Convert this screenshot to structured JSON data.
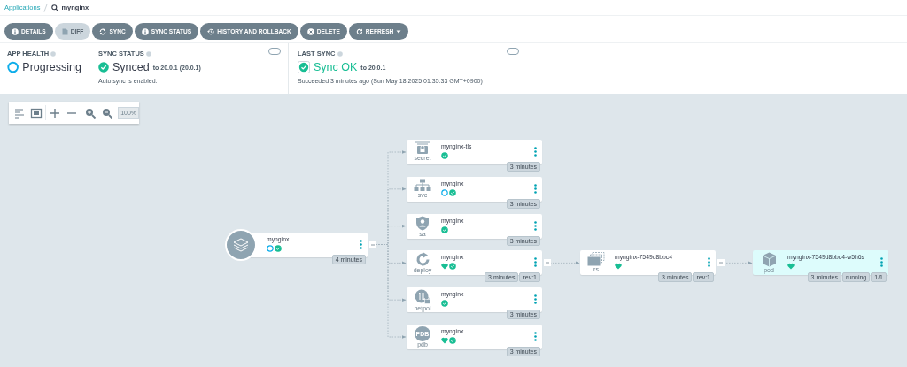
{
  "breadcrumb": [
    {
      "label": "Applications",
      "kind": "link"
    },
    {
      "label": "mynginx",
      "kind": "current"
    }
  ],
  "actions": [
    {
      "label": "DETAILS",
      "kind": "info",
      "disabled": false
    },
    {
      "label": "DIFF",
      "kind": "file",
      "disabled": true
    },
    {
      "label": "SYNC",
      "kind": "sync",
      "disabled": false
    },
    {
      "label": "SYNC STATUS",
      "kind": "info",
      "disabled": false
    },
    {
      "label": "HISTORY AND ROLLBACK",
      "kind": "history",
      "disabled": false
    },
    {
      "label": "DELETE",
      "kind": "delete",
      "disabled": false
    },
    {
      "label": "REFRESH",
      "kind": "refresh",
      "disabled": false,
      "dropdown": true
    }
  ],
  "summary": {
    "app_health": {
      "label": "APP HEALTH",
      "kind": "progressing",
      "value": "Progressing"
    },
    "sync_status": {
      "label": "SYNC STATUS",
      "kind": "synced",
      "value": "Synced",
      "revision": "to 20.0.1 (20.0.1)",
      "note": "Auto sync is enabled."
    },
    "last_sync": {
      "label": "LAST SYNC",
      "kind": "succeeded",
      "value": "Sync OK",
      "revision": "to 20.0.1",
      "note": "Succeeded 3 minutes ago (Sun May 18 2025 01:35:33 GMT+0900)"
    }
  },
  "graph": {
    "zoom": "100%",
    "root": {
      "kind": "app",
      "name": "mynginx",
      "statuses": [
        {
          "kind": "progressing"
        },
        {
          "kind": "synced"
        }
      ],
      "tags": [
        "4 minutes"
      ],
      "expanded": true,
      "children": [
        {
          "kind": "secret",
          "type_label": "secret",
          "name": "mynginx-tls",
          "statuses": [
            {
              "kind": "synced"
            }
          ],
          "tags": [
            "3 minutes"
          ]
        },
        {
          "kind": "svc",
          "type_label": "svc",
          "name": "mynginx",
          "statuses": [
            {
              "kind": "progressing"
            },
            {
              "kind": "synced"
            }
          ],
          "tags": [
            "3 minutes"
          ]
        },
        {
          "kind": "sa",
          "type_label": "sa",
          "name": "mynginx",
          "statuses": [
            {
              "kind": "synced"
            }
          ],
          "tags": [
            "3 minutes"
          ]
        },
        {
          "kind": "deploy",
          "type_label": "deploy",
          "name": "mynginx",
          "statuses": [
            {
              "kind": "healthy"
            },
            {
              "kind": "synced"
            }
          ],
          "tags": [
            "3 minutes",
            "rev:1"
          ],
          "expanded": true,
          "children": [
            {
              "kind": "rs",
              "type_label": "rs",
              "name": "mynginx-7549d8bbc4",
              "statuses": [
                {
                  "kind": "healthy"
                }
              ],
              "tags": [
                "3 minutes",
                "rev:1"
              ],
              "expanded": true,
              "children": [
                {
                  "kind": "pod",
                  "type_label": "pod",
                  "name": "mynginx-7549d8bbc4-w5h6s",
                  "statuses": [
                    {
                      "kind": "healthy"
                    }
                  ],
                  "tags": [
                    "3 minutes",
                    "running",
                    "1/1"
                  ]
                }
              ]
            }
          ]
        },
        {
          "kind": "netpol",
          "type_label": "netpol",
          "name": "mynginx",
          "statuses": [
            {
              "kind": "synced"
            }
          ],
          "tags": [
            "3 minutes"
          ]
        },
        {
          "kind": "pdb",
          "type_label": "pdb",
          "badge": "PDB",
          "name": "mynginx",
          "statuses": [
            {
              "kind": "healthy"
            },
            {
              "kind": "synced"
            }
          ],
          "tags": [
            "3 minutes"
          ]
        }
      ]
    }
  }
}
